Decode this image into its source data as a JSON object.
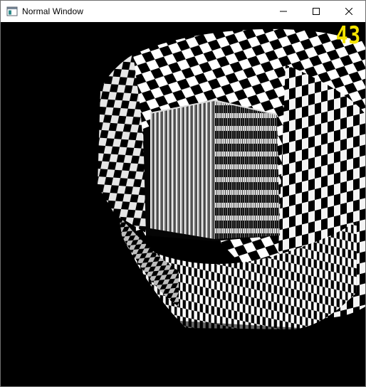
{
  "window": {
    "title": "Normal Window",
    "icon": "application-window-icon"
  },
  "caption": {
    "minimize_icon": "minimize-icon",
    "maximize_icon": "maximize-icon",
    "close_icon": "close-icon"
  },
  "scene": {
    "fps_counter": "43",
    "fps_color": "#f5e400",
    "background_color": "#000000",
    "texture": "black-and-white checkerboard"
  }
}
